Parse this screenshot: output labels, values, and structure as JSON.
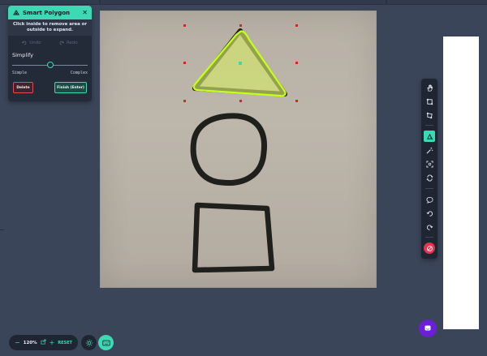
{
  "smart_polygon": {
    "title": "Smart Polygon",
    "close_glyph": "✕",
    "instructions": "Click inside to remove area or outside to expand.",
    "undo_label": "Undo",
    "redo_label": "Redo",
    "simplify_label": "Simplify",
    "simplify_value": 0.5,
    "slider_min_label": "Simple",
    "slider_max_label": "Complex",
    "delete_label": "Delete",
    "finish_label": "Finish (Enter)"
  },
  "toolbar": {
    "items": [
      {
        "name": "hand-tool",
        "icon": "hand-icon"
      },
      {
        "name": "bounding-box-tool",
        "icon": "box-icon"
      },
      {
        "name": "polygon-tool",
        "icon": "polygon-icon"
      },
      {
        "name": "smart-polygon-tool",
        "icon": "smart-polygon-icon",
        "active": true
      },
      {
        "name": "magic-wand-tool",
        "icon": "magic-wand-icon"
      },
      {
        "name": "auto-label-tool",
        "icon": "auto-label-icon"
      },
      {
        "name": "repeat-tool",
        "icon": "repeat-icon"
      },
      {
        "name": "comment-tool",
        "icon": "comment-icon"
      },
      {
        "name": "undo-tool",
        "icon": "undo-icon"
      },
      {
        "name": "redo-tool",
        "icon": "redo-icon"
      },
      {
        "name": "hide-annotations-tool",
        "icon": "eye-off-icon",
        "danger": true
      }
    ]
  },
  "zoom": {
    "minus": "−",
    "level": "120%",
    "plus": "+",
    "reset_label": "RESET"
  },
  "colors": {
    "accent": "#3cd9b4",
    "danger": "#e2344c",
    "polygon_fill": "#d4e86a",
    "chat": "#6b1fd6"
  }
}
